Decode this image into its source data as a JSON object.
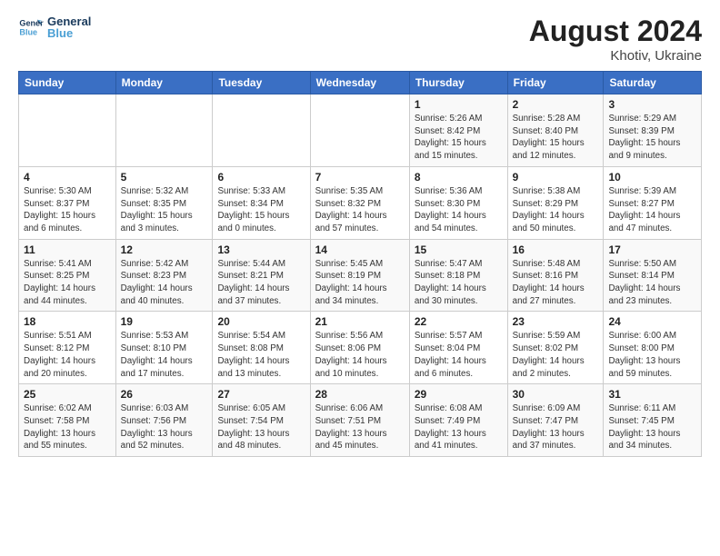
{
  "header": {
    "logo_line1": "General",
    "logo_line2": "Blue",
    "title": "August 2024",
    "subtitle": "Khotiv, Ukraine"
  },
  "weekdays": [
    "Sunday",
    "Monday",
    "Tuesday",
    "Wednesday",
    "Thursday",
    "Friday",
    "Saturday"
  ],
  "weeks": [
    [
      {
        "day": "",
        "info": ""
      },
      {
        "day": "",
        "info": ""
      },
      {
        "day": "",
        "info": ""
      },
      {
        "day": "",
        "info": ""
      },
      {
        "day": "1",
        "info": "Sunrise: 5:26 AM\nSunset: 8:42 PM\nDaylight: 15 hours\nand 15 minutes."
      },
      {
        "day": "2",
        "info": "Sunrise: 5:28 AM\nSunset: 8:40 PM\nDaylight: 15 hours\nand 12 minutes."
      },
      {
        "day": "3",
        "info": "Sunrise: 5:29 AM\nSunset: 8:39 PM\nDaylight: 15 hours\nand 9 minutes."
      }
    ],
    [
      {
        "day": "4",
        "info": "Sunrise: 5:30 AM\nSunset: 8:37 PM\nDaylight: 15 hours\nand 6 minutes."
      },
      {
        "day": "5",
        "info": "Sunrise: 5:32 AM\nSunset: 8:35 PM\nDaylight: 15 hours\nand 3 minutes."
      },
      {
        "day": "6",
        "info": "Sunrise: 5:33 AM\nSunset: 8:34 PM\nDaylight: 15 hours\nand 0 minutes."
      },
      {
        "day": "7",
        "info": "Sunrise: 5:35 AM\nSunset: 8:32 PM\nDaylight: 14 hours\nand 57 minutes."
      },
      {
        "day": "8",
        "info": "Sunrise: 5:36 AM\nSunset: 8:30 PM\nDaylight: 14 hours\nand 54 minutes."
      },
      {
        "day": "9",
        "info": "Sunrise: 5:38 AM\nSunset: 8:29 PM\nDaylight: 14 hours\nand 50 minutes."
      },
      {
        "day": "10",
        "info": "Sunrise: 5:39 AM\nSunset: 8:27 PM\nDaylight: 14 hours\nand 47 minutes."
      }
    ],
    [
      {
        "day": "11",
        "info": "Sunrise: 5:41 AM\nSunset: 8:25 PM\nDaylight: 14 hours\nand 44 minutes."
      },
      {
        "day": "12",
        "info": "Sunrise: 5:42 AM\nSunset: 8:23 PM\nDaylight: 14 hours\nand 40 minutes."
      },
      {
        "day": "13",
        "info": "Sunrise: 5:44 AM\nSunset: 8:21 PM\nDaylight: 14 hours\nand 37 minutes."
      },
      {
        "day": "14",
        "info": "Sunrise: 5:45 AM\nSunset: 8:19 PM\nDaylight: 14 hours\nand 34 minutes."
      },
      {
        "day": "15",
        "info": "Sunrise: 5:47 AM\nSunset: 8:18 PM\nDaylight: 14 hours\nand 30 minutes."
      },
      {
        "day": "16",
        "info": "Sunrise: 5:48 AM\nSunset: 8:16 PM\nDaylight: 14 hours\nand 27 minutes."
      },
      {
        "day": "17",
        "info": "Sunrise: 5:50 AM\nSunset: 8:14 PM\nDaylight: 14 hours\nand 23 minutes."
      }
    ],
    [
      {
        "day": "18",
        "info": "Sunrise: 5:51 AM\nSunset: 8:12 PM\nDaylight: 14 hours\nand 20 minutes."
      },
      {
        "day": "19",
        "info": "Sunrise: 5:53 AM\nSunset: 8:10 PM\nDaylight: 14 hours\nand 17 minutes."
      },
      {
        "day": "20",
        "info": "Sunrise: 5:54 AM\nSunset: 8:08 PM\nDaylight: 14 hours\nand 13 minutes."
      },
      {
        "day": "21",
        "info": "Sunrise: 5:56 AM\nSunset: 8:06 PM\nDaylight: 14 hours\nand 10 minutes."
      },
      {
        "day": "22",
        "info": "Sunrise: 5:57 AM\nSunset: 8:04 PM\nDaylight: 14 hours\nand 6 minutes."
      },
      {
        "day": "23",
        "info": "Sunrise: 5:59 AM\nSunset: 8:02 PM\nDaylight: 14 hours\nand 2 minutes."
      },
      {
        "day": "24",
        "info": "Sunrise: 6:00 AM\nSunset: 8:00 PM\nDaylight: 13 hours\nand 59 minutes."
      }
    ],
    [
      {
        "day": "25",
        "info": "Sunrise: 6:02 AM\nSunset: 7:58 PM\nDaylight: 13 hours\nand 55 minutes."
      },
      {
        "day": "26",
        "info": "Sunrise: 6:03 AM\nSunset: 7:56 PM\nDaylight: 13 hours\nand 52 minutes."
      },
      {
        "day": "27",
        "info": "Sunrise: 6:05 AM\nSunset: 7:54 PM\nDaylight: 13 hours\nand 48 minutes."
      },
      {
        "day": "28",
        "info": "Sunrise: 6:06 AM\nSunset: 7:51 PM\nDaylight: 13 hours\nand 45 minutes."
      },
      {
        "day": "29",
        "info": "Sunrise: 6:08 AM\nSunset: 7:49 PM\nDaylight: 13 hours\nand 41 minutes."
      },
      {
        "day": "30",
        "info": "Sunrise: 6:09 AM\nSunset: 7:47 PM\nDaylight: 13 hours\nand 37 minutes."
      },
      {
        "day": "31",
        "info": "Sunrise: 6:11 AM\nSunset: 7:45 PM\nDaylight: 13 hours\nand 34 minutes."
      }
    ]
  ]
}
